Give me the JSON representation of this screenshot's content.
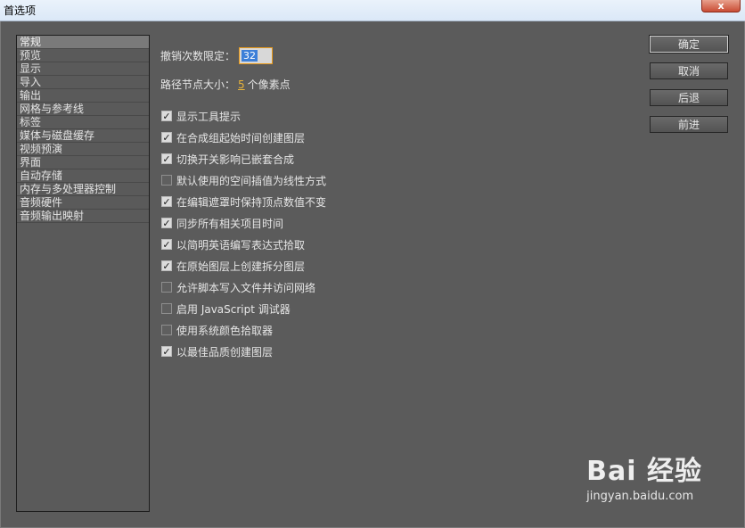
{
  "window": {
    "title": "首选项",
    "close_label": "x"
  },
  "categories": [
    {
      "label": "常规",
      "selected": true
    },
    {
      "label": "预览"
    },
    {
      "label": "显示"
    },
    {
      "label": "导入"
    },
    {
      "label": "输出"
    },
    {
      "label": "网格与参考线"
    },
    {
      "label": "标签"
    },
    {
      "label": "媒体与磁盘缓存"
    },
    {
      "label": "视频预演"
    },
    {
      "label": "界面"
    },
    {
      "label": "自动存储"
    },
    {
      "label": "内存与多处理器控制"
    },
    {
      "label": "音频硬件"
    },
    {
      "label": "音频输出映射"
    }
  ],
  "general": {
    "undo_label": "撤销次数限定：",
    "undo_value": "32",
    "path_label": "路径节点大小：",
    "path_value": "5",
    "path_unit": "个像素点",
    "options": [
      {
        "label": "显示工具提示",
        "checked": true
      },
      {
        "label": "在合成组起始时间创建图层",
        "checked": true
      },
      {
        "label": "切换开关影响已嵌套合成",
        "checked": true
      },
      {
        "label": "默认使用的空间插值为线性方式",
        "checked": false
      },
      {
        "label": "在编辑遮罩时保持顶点数值不变",
        "checked": true
      },
      {
        "label": "同步所有相关项目时间",
        "checked": true
      },
      {
        "label": "以简明英语编写表达式拾取",
        "checked": true
      },
      {
        "label": "在原始图层上创建拆分图层",
        "checked": true
      },
      {
        "label": "允许脚本写入文件并访问网络",
        "checked": false
      },
      {
        "label": "启用 JavaScript 调试器",
        "checked": false
      },
      {
        "label": "使用系统颜色拾取器",
        "checked": false
      },
      {
        "label": "以最佳品质创建图层",
        "checked": true
      }
    ]
  },
  "buttons": {
    "ok": "确定",
    "cancel": "取消",
    "back": "后退",
    "forward": "前进"
  },
  "watermark": {
    "logo": "Bai 经验",
    "url": "jingyan.baidu.com"
  },
  "colors": {
    "background": "#5b5b5b",
    "accent": "#e89a1a",
    "selection": "#3c7fd8"
  }
}
